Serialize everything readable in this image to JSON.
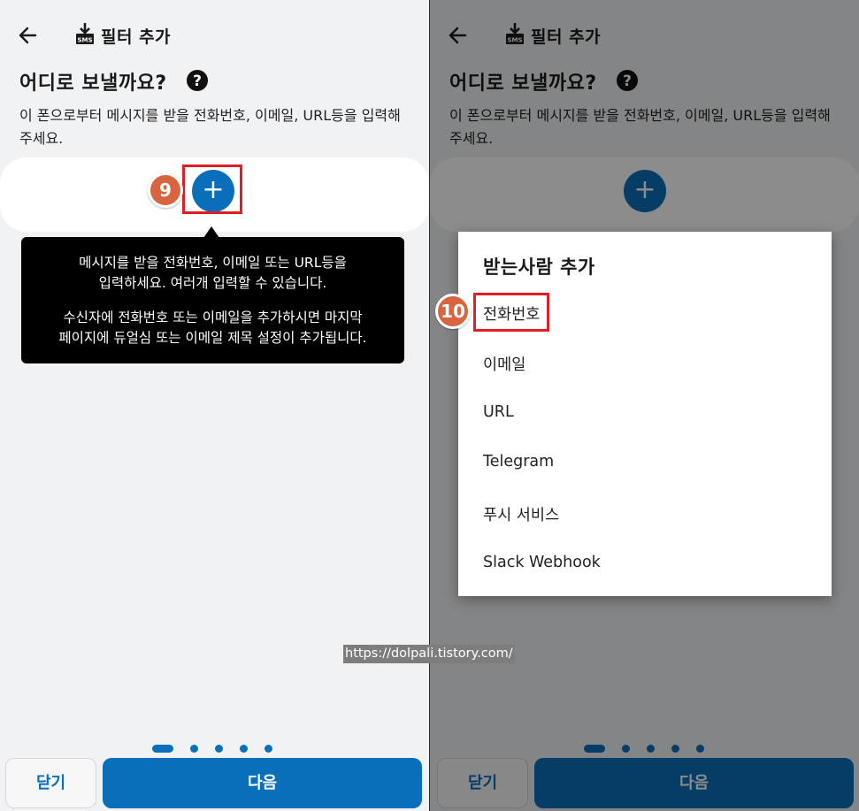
{
  "screen": {
    "title": "필터 추가",
    "heading": "어디로 보낼까요?",
    "description": "이 폰으로부터 메시지를 받을 전화번호, 이메일, URL등을 입력해주세요.",
    "add_button_glyph": "+",
    "close_label": "닫기",
    "next_label": "다음"
  },
  "tooltip": {
    "line1": "메시지를 받을 전화번호, 이메일 또는 URL등을",
    "line2": "입력하세요. 여러개 입력할 수 있습니다.",
    "line3": "수신자에 전화번호 또는 이메일을 추가하시면 마지막",
    "line4": "페이지에 듀얼심 또는 이메일 제목 설정이 추가됩니다."
  },
  "pager": {
    "total": 5,
    "active": 1
  },
  "dialog": {
    "title": "받는사람 추가",
    "options": [
      "전화번호",
      "이메일",
      "URL",
      "Telegram",
      "푸시 서비스",
      "Slack Webhook"
    ]
  },
  "annotations": {
    "step_left": "9",
    "step_right": "10"
  },
  "watermark": "https://dolpali.tistory.com/",
  "colors": {
    "primary": "#0a6fba",
    "highlight": "#e01f25",
    "badge": "#d8653f",
    "background": "#f1f2f4"
  },
  "icons": {
    "back": "arrow-left-icon",
    "sms": "sms-download-icon",
    "help": "question-circle-icon"
  }
}
